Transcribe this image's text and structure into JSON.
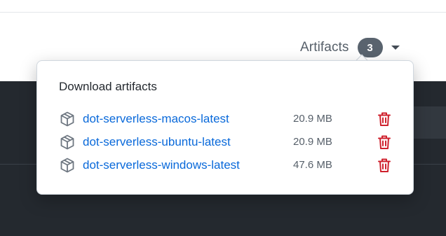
{
  "artifacts": {
    "label": "Artifacts",
    "count": "3"
  },
  "popover": {
    "title": "Download artifacts",
    "items": [
      {
        "name": "dot-serverless-macos-latest",
        "size": "20.9 MB"
      },
      {
        "name": "dot-serverless-ubuntu-latest",
        "size": "20.9 MB"
      },
      {
        "name": "dot-serverless-windows-latest",
        "size": "47.6 MB"
      }
    ]
  },
  "icons": {
    "package": "package-icon",
    "delete": "trash-icon",
    "toggle": "caret-down-icon"
  },
  "colors": {
    "link": "#0969da",
    "danger": "#cf222e",
    "counter_bg": "#59636e"
  }
}
